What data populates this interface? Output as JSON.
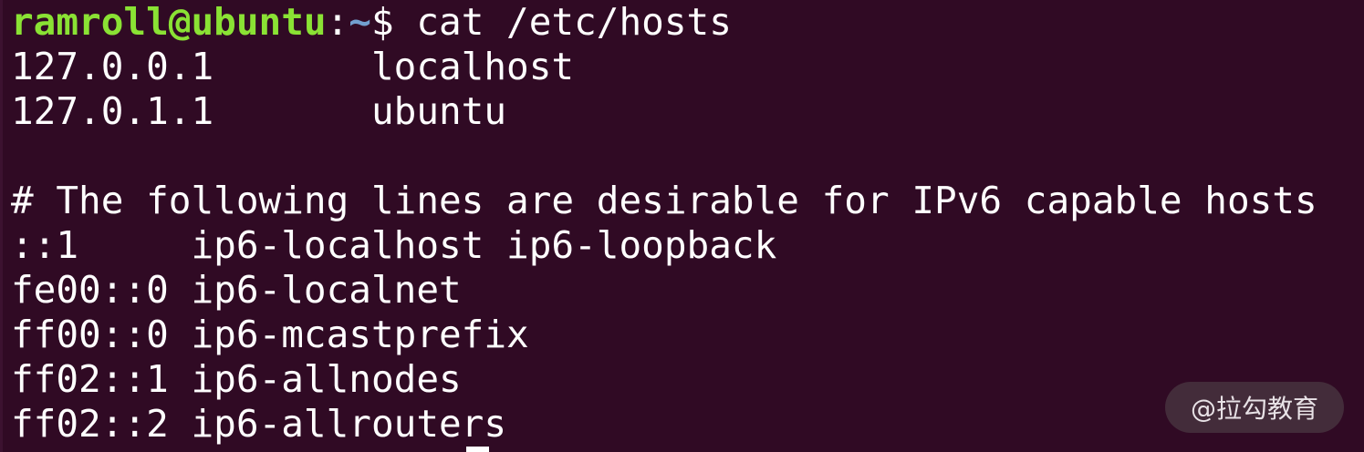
{
  "terminal": {
    "prompt": {
      "user_host": "ramroll@ubuntu",
      "colon": ":",
      "path": "~",
      "symbol": "$",
      "command": " cat /etc/hosts"
    },
    "output": [
      "127.0.0.1       localhost",
      "127.0.1.1       ubuntu",
      "",
      "# The following lines are desirable for IPv6 capable hosts",
      "::1     ip6-localhost ip6-loopback",
      "fe00::0 ip6-localnet",
      "ff00::0 ip6-mcastprefix",
      "ff02::1 ip6-allnodes",
      "ff02::2 ip6-allrouters"
    ]
  },
  "watermark": {
    "text": "@拉勾教育"
  },
  "colors": {
    "background": "#300a24",
    "prompt_user": "#8ae234",
    "prompt_path": "#729fcf",
    "text": "#ffffff"
  }
}
